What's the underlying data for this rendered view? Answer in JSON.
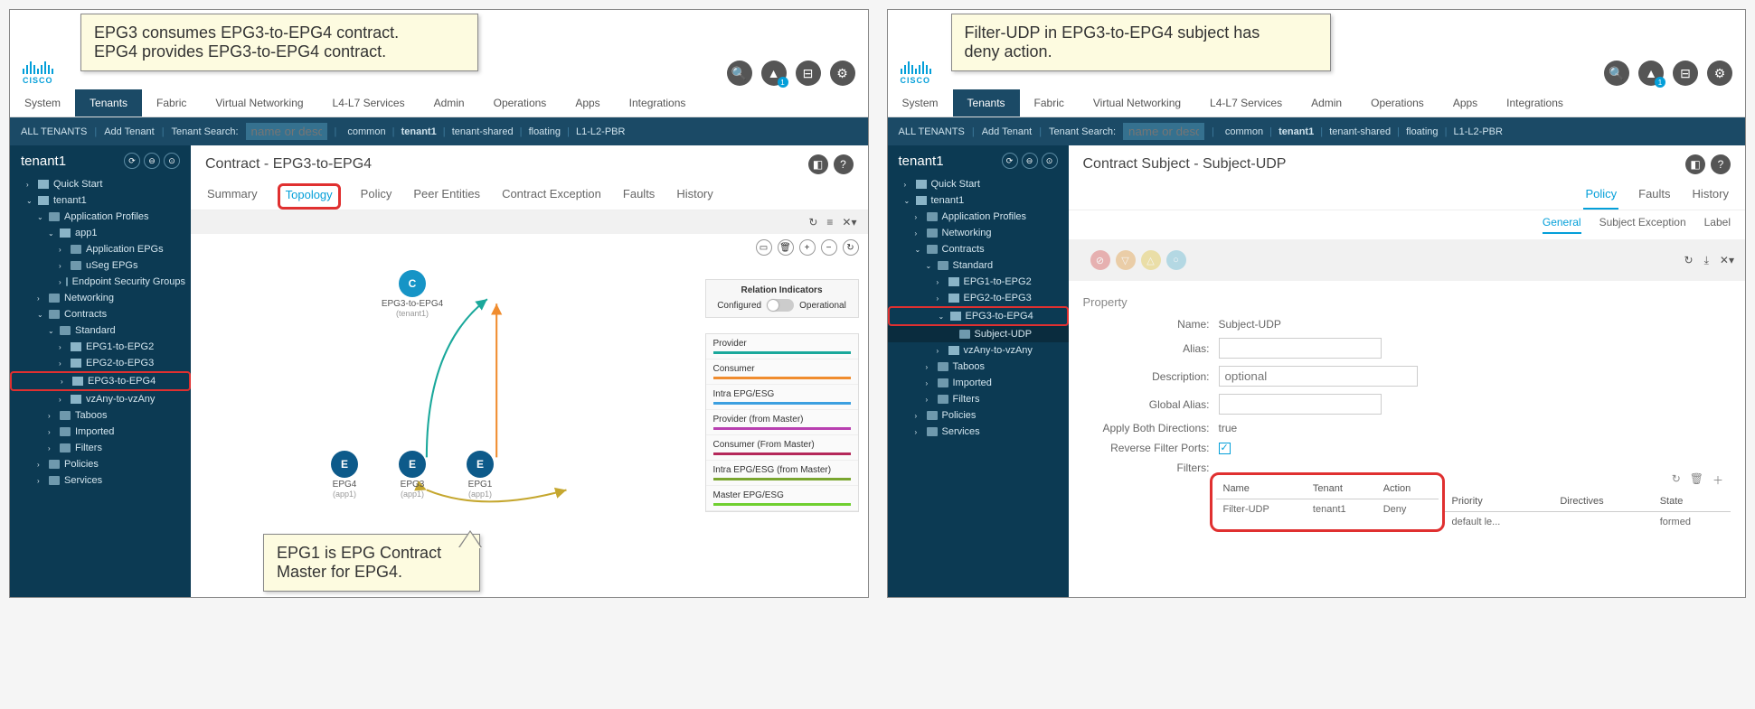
{
  "brand": "CISCO",
  "menu": {
    "items": [
      "System",
      "Tenants",
      "Fabric",
      "Virtual Networking",
      "L4-L7 Services",
      "Admin",
      "Operations",
      "Apps",
      "Integrations"
    ],
    "active": "Tenants"
  },
  "submenu": {
    "all": "ALL TENANTS",
    "add": "Add Tenant",
    "search_label": "Tenant Search:",
    "search_ph": "name or descr",
    "links": [
      "common",
      "tenant1",
      "tenant-shared",
      "floating",
      "L1-L2-PBR"
    ]
  },
  "tenant": "tenant1",
  "tree_left": [
    {
      "t": "Quick Start",
      "d": 1,
      "chev": ">",
      "icon": "clock"
    },
    {
      "t": "tenant1",
      "d": 1,
      "chev": "v",
      "icon": "grid"
    },
    {
      "t": "Application Profiles",
      "d": 2,
      "chev": "v",
      "icon": "folder"
    },
    {
      "t": "app1",
      "d": 3,
      "chev": "v",
      "icon": "globe"
    },
    {
      "t": "Application EPGs",
      "d": 4,
      "chev": ">",
      "icon": "folder"
    },
    {
      "t": "uSeg EPGs",
      "d": 4,
      "chev": ">",
      "icon": "folder"
    },
    {
      "t": "Endpoint Security Groups",
      "d": 4,
      "chev": ">",
      "icon": "folder"
    },
    {
      "t": "Networking",
      "d": 2,
      "chev": ">",
      "icon": "folder"
    },
    {
      "t": "Contracts",
      "d": 2,
      "chev": "v",
      "icon": "folder"
    },
    {
      "t": "Standard",
      "d": 3,
      "chev": "v",
      "icon": "folder"
    },
    {
      "t": "EPG1-to-EPG2",
      "d": 4,
      "chev": ">",
      "icon": "contract"
    },
    {
      "t": "EPG2-to-EPG3",
      "d": 4,
      "chev": ">",
      "icon": "contract"
    },
    {
      "t": "EPG3-to-EPG4",
      "d": 4,
      "chev": ">",
      "icon": "contract",
      "hl": true
    },
    {
      "t": "vzAny-to-vzAny",
      "d": 4,
      "chev": ">",
      "icon": "contract"
    },
    {
      "t": "Taboos",
      "d": 3,
      "chev": ">",
      "icon": "folder"
    },
    {
      "t": "Imported",
      "d": 3,
      "chev": ">",
      "icon": "folder"
    },
    {
      "t": "Filters",
      "d": 3,
      "chev": ">",
      "icon": "folder"
    },
    {
      "t": "Policies",
      "d": 2,
      "chev": ">",
      "icon": "folder"
    },
    {
      "t": "Services",
      "d": 2,
      "chev": ">",
      "icon": "folder"
    }
  ],
  "tree_right": [
    {
      "t": "Quick Start",
      "d": 1,
      "chev": ">",
      "icon": "clock"
    },
    {
      "t": "tenant1",
      "d": 1,
      "chev": "v",
      "icon": "grid"
    },
    {
      "t": "Application Profiles",
      "d": 2,
      "chev": ">",
      "icon": "folder"
    },
    {
      "t": "Networking",
      "d": 2,
      "chev": ">",
      "icon": "folder"
    },
    {
      "t": "Contracts",
      "d": 2,
      "chev": "v",
      "icon": "folder"
    },
    {
      "t": "Standard",
      "d": 3,
      "chev": "v",
      "icon": "folder"
    },
    {
      "t": "EPG1-to-EPG2",
      "d": 4,
      "chev": ">",
      "icon": "contract"
    },
    {
      "t": "EPG2-to-EPG3",
      "d": 4,
      "chev": ">",
      "icon": "contract"
    },
    {
      "t": "EPG3-to-EPG4",
      "d": 4,
      "chev": "v",
      "icon": "contract",
      "hl": true
    },
    {
      "t": "Subject-UDP",
      "d": 5,
      "chev": "",
      "icon": "folder",
      "sel": true
    },
    {
      "t": "vzAny-to-vzAny",
      "d": 4,
      "chev": ">",
      "icon": "contract"
    },
    {
      "t": "Taboos",
      "d": 3,
      "chev": ">",
      "icon": "folder"
    },
    {
      "t": "Imported",
      "d": 3,
      "chev": ">",
      "icon": "folder"
    },
    {
      "t": "Filters",
      "d": 3,
      "chev": ">",
      "icon": "folder"
    },
    {
      "t": "Policies",
      "d": 2,
      "chev": ">",
      "icon": "folder"
    },
    {
      "t": "Services",
      "d": 2,
      "chev": ">",
      "icon": "folder"
    }
  ],
  "left_main": {
    "title": "Contract - EPG3-to-EPG4",
    "tabs": [
      "Summary",
      "Topology",
      "Policy",
      "Peer Entities",
      "Contract Exception",
      "Faults",
      "History"
    ],
    "active_tab": "Topology",
    "relation_ind": {
      "title": "Relation Indicators",
      "left": "Configured",
      "right": "Operational"
    },
    "legend": [
      {
        "label": "Provider",
        "color": "#1aa89b"
      },
      {
        "label": "Consumer",
        "color": "#f08c2e"
      },
      {
        "label": "Intra EPG/ESG",
        "color": "#3b9fe0"
      },
      {
        "label": "Provider (from Master)",
        "color": "#b83fb0"
      },
      {
        "label": "Consumer (From Master)",
        "color": "#b5285a"
      },
      {
        "label": "Intra EPG/ESG (from Master)",
        "color": "#7aa630"
      },
      {
        "label": "Master EPG/ESG",
        "color": "#6fcf2f"
      }
    ],
    "nodes": {
      "c": {
        "label": "EPG3-to-EPG4",
        "sub": "(tenant1)"
      },
      "e4": {
        "label": "EPG4",
        "sub": "(app1)"
      },
      "e3": {
        "label": "EPG3",
        "sub": "(app1)"
      },
      "e1": {
        "label": "EPG1",
        "sub": "(app1)"
      }
    }
  },
  "right_main": {
    "title": "Contract Subject - Subject-UDP",
    "tabs": [
      "Policy",
      "Faults",
      "History"
    ],
    "active_tab": "Policy",
    "subtabs": [
      "General",
      "Subject Exception",
      "Label"
    ],
    "active_subtab": "General",
    "section": "Property",
    "fields": {
      "name_lbl": "Name:",
      "name_val": "Subject-UDP",
      "alias_lbl": "Alias:",
      "alias_val": "",
      "desc_lbl": "Description:",
      "desc_ph": "optional",
      "galias_lbl": "Global Alias:",
      "galias_val": "",
      "apply_lbl": "Apply Both Directions:",
      "apply_val": "true",
      "rev_lbl": "Reverse Filter Ports:",
      "filters_lbl": "Filters:"
    },
    "filter_cols": [
      "Name",
      "Tenant",
      "Action",
      "Priority",
      "Directives",
      "State"
    ],
    "filter_row": {
      "name": "Filter-UDP",
      "tenant": "tenant1",
      "action": "Deny",
      "priority": "default le...",
      "directives": "",
      "state": "formed"
    }
  },
  "callouts": {
    "c1": "EPG3 consumes EPG3-to-EPG4 contract.\nEPG4 provides EPG3-to-EPG4 contract.",
    "c2": "Filter-UDP in EPG3-to-EPG4 subject has\ndeny action.",
    "c3": "EPG1 is EPG Contract\nMaster for EPG4."
  }
}
